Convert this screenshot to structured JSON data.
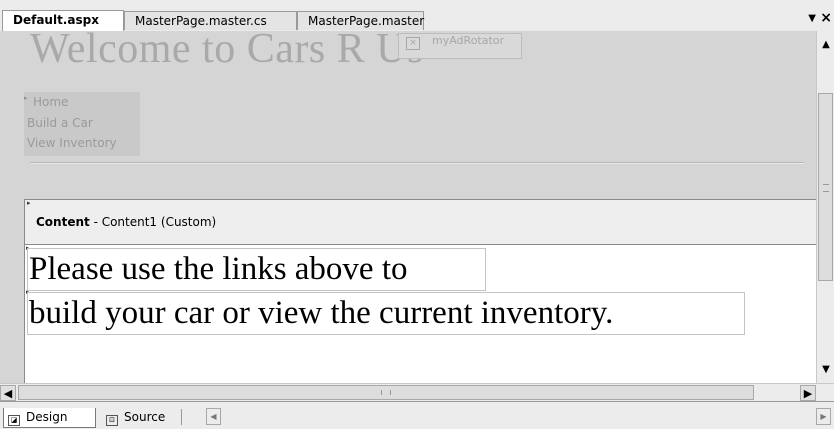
{
  "tabs": [
    {
      "label": "Default.aspx",
      "active": true
    },
    {
      "label": "MasterPage.master.cs",
      "active": false
    },
    {
      "label": "MasterPage.master",
      "active": false
    }
  ],
  "tabbar": {
    "menu_glyph": "▼",
    "close_glyph": "×"
  },
  "master": {
    "title": "Welcome to Cars R Us",
    "adrotator_label": "myAdRotator",
    "menu_items": [
      "Home",
      "Build a Car",
      "View Inventory"
    ]
  },
  "content": {
    "header_bold": "Content",
    "header_rest": " - Content1 (Custom)",
    "paragraphs": [
      "Please use the links above to",
      "build your car or view the current inventory."
    ]
  },
  "view_tabs": [
    {
      "label": "Design",
      "icon": "design-view-icon",
      "active": true
    },
    {
      "label": "Source",
      "icon": "source-view-icon",
      "active": false
    }
  ],
  "colors": {
    "background": "#ececec",
    "surface": "#d5d5d5",
    "master_text": "#a9a9a9",
    "content_bg": "#ffffff"
  }
}
